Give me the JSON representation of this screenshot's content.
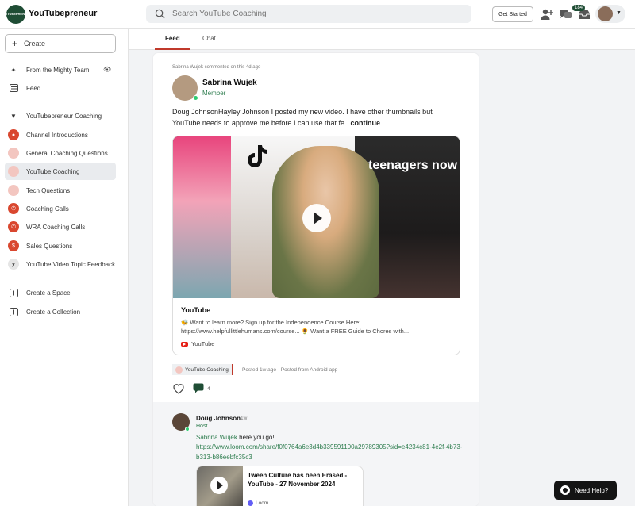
{
  "app": {
    "logo_text": "YOUTUBEPRENEUR",
    "title": "YouTubepreneur"
  },
  "header": {
    "search_placeholder": "Search YouTube Coaching",
    "get_started_label": "Get Started",
    "notification_count": "184",
    "icons": [
      "search-icon",
      "add-person-icon",
      "chat-bubbles-icon",
      "inbox-icon",
      "chevron-down-icon"
    ]
  },
  "sidebar": {
    "create_label": "Create",
    "top_items": [
      {
        "label": "From the Mighty Team",
        "icon": "sparkle-icon"
      },
      {
        "label": "Feed",
        "icon": "feed-icon"
      }
    ],
    "section_label": "YouTubepreneur Coaching",
    "spaces": [
      {
        "label": "Channel Introductions"
      },
      {
        "label": "General Coaching Questions"
      },
      {
        "label": "YouTube Coaching",
        "active": true
      },
      {
        "label": "Tech Questions"
      },
      {
        "label": "Coaching Calls"
      },
      {
        "label": "WRA Coaching Calls"
      },
      {
        "label": "Sales Questions"
      },
      {
        "label": "YouTube Video Topic Feedback"
      }
    ],
    "create_space_label": "Create a Space",
    "create_collection_label": "Create a Collection"
  },
  "tabs": [
    {
      "label": "Feed",
      "active": true
    },
    {
      "label": "Chat",
      "active": false
    }
  ],
  "post": {
    "activity": "Sabrina Wujek commented on this 4d ago",
    "author": "Sabrina Wujek",
    "role": "Member",
    "body": "Doug JohnsonHayley Johnson I posted my new video. I have other thumbnails but YouTube needs to approve me before I can use that fe...",
    "continue_label": "continue",
    "embed": {
      "overlay_text": "teenagers now",
      "title": "YouTube",
      "description": "🐝 Want to learn more? Sign up for the Independence Course Here: https://www.helpfullittlehumans.com/course... 🌻 Want a FREE Guide to Chores with...",
      "source": "YouTube"
    },
    "space_tag": "YouTube Coaching",
    "posted_meta": "Posted 1w ago  ·  Posted from Android app",
    "comment_count": "4"
  },
  "reply": {
    "author": "Doug Johnson",
    "time": "1w",
    "role": "Host",
    "mention": "Sabrina Wujek",
    "text": " here you go!",
    "link": "https://www.loom.com/share/f0f0764a6e3d4b339591100a29789305?sid=e4234c81-4e2f-4b73-b313-b86eebfc35c3",
    "loom_title": "Tween Culture has been Erased - YouTube - 27 November 2024",
    "loom_source": "Loom"
  },
  "help": {
    "label": "Need Help?"
  },
  "colors": {
    "brand_green": "#1f4d35",
    "accent_red": "#c0392b",
    "link_green": "#2e7d4f"
  }
}
